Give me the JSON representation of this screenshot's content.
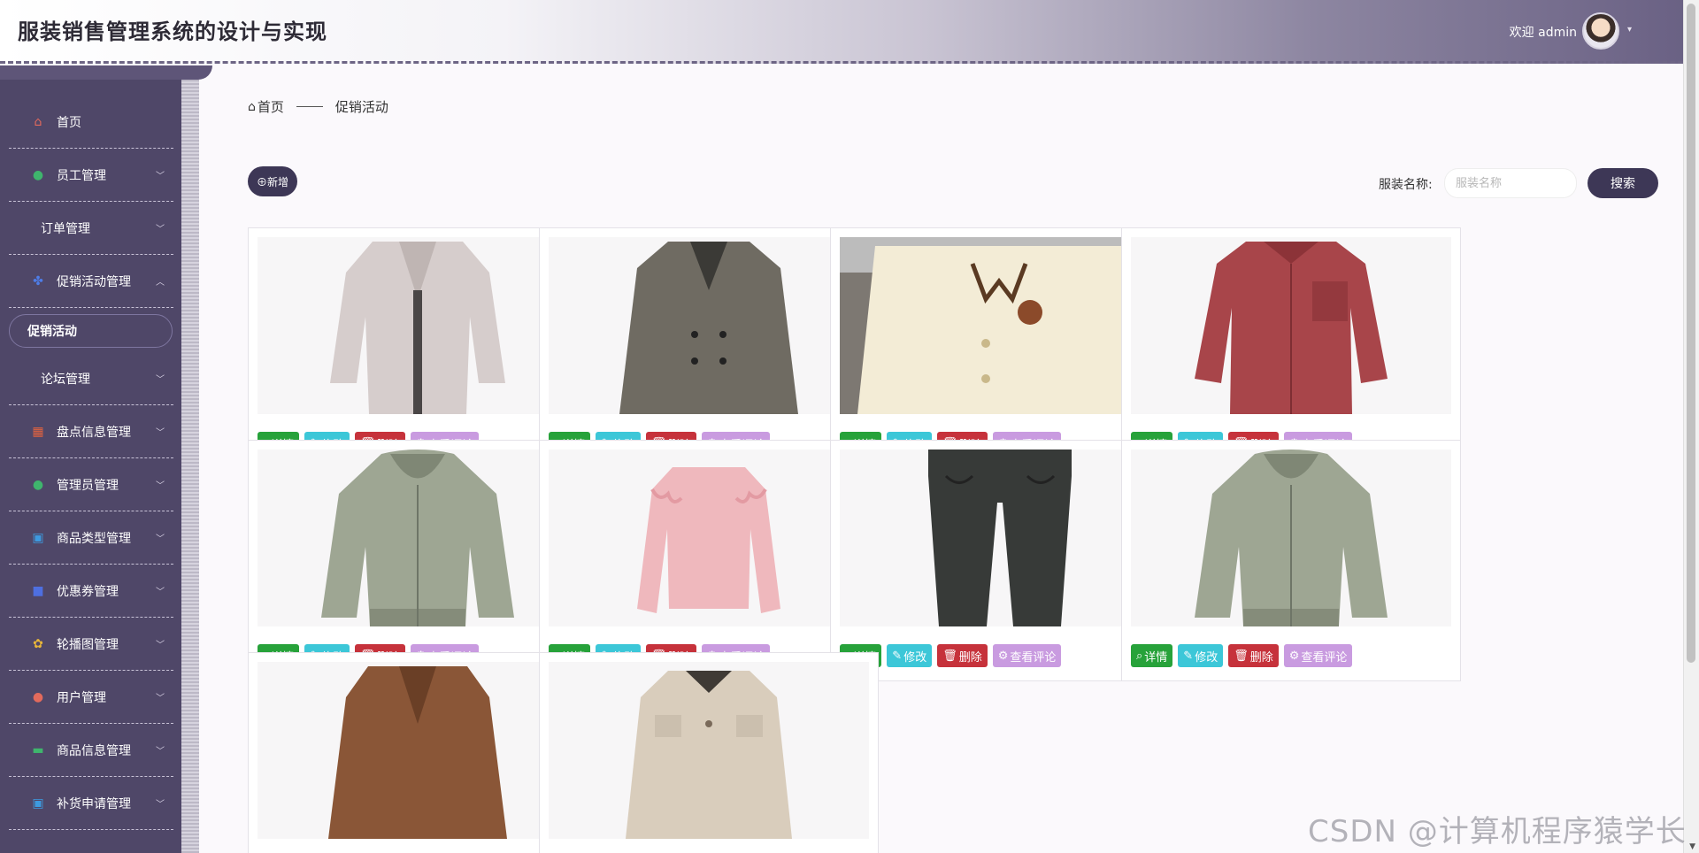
{
  "header": {
    "title": "服装销售管理系统的设计与实现",
    "welcome": "欢迎 admin"
  },
  "sidebar": {
    "items": [
      {
        "label": "首页",
        "icon": "home-icon",
        "color": "#e36a5c",
        "chevron": false,
        "iconShown": true
      },
      {
        "label": "员工管理",
        "icon": "person-icon",
        "color": "#3fb56d",
        "chevron": true,
        "iconShown": true
      },
      {
        "label": "订单管理",
        "icon": "",
        "color": "",
        "chevron": true,
        "iconShown": false
      },
      {
        "label": "促销活动管理",
        "icon": "grid-flower-icon",
        "color": "#4e7de8",
        "chevron": true,
        "expanded": true,
        "iconShown": true
      },
      {
        "label": "论坛管理",
        "icon": "",
        "color": "",
        "chevron": true,
        "iconShown": false
      },
      {
        "label": "盘点信息管理",
        "icon": "table-icon",
        "color": "#e3633f",
        "chevron": true,
        "iconShown": true
      },
      {
        "label": "管理员管理",
        "icon": "person-icon",
        "color": "#3fb56d",
        "chevron": true,
        "iconShown": true
      },
      {
        "label": "商品类型管理",
        "icon": "window-icon",
        "color": "#3d9ae0",
        "chevron": true,
        "iconShown": true
      },
      {
        "label": "优惠券管理",
        "icon": "folder-icon",
        "color": "#4e6fe0",
        "chevron": true,
        "iconShown": true
      },
      {
        "label": "轮播图管理",
        "icon": "flower-icon",
        "color": "#e8b63a",
        "chevron": true,
        "iconShown": true
      },
      {
        "label": "用户管理",
        "icon": "person-icon",
        "color": "#e36a5c",
        "chevron": true,
        "iconShown": true
      },
      {
        "label": "商品信息管理",
        "icon": "chat-icon",
        "color": "#3fb56d",
        "chevron": true,
        "iconShown": true
      },
      {
        "label": "补货申请管理",
        "icon": "window-icon",
        "color": "#3d9ae0",
        "chevron": true,
        "iconShown": true
      }
    ],
    "active_sub": "促销活动"
  },
  "breadcrumb": {
    "home": "首页",
    "current": "促销活动"
  },
  "toolbar": {
    "add_label": "⊕新增",
    "search_label": "服装名称:",
    "search_placeholder": "服装名称",
    "search_button": "搜索"
  },
  "card_actions": {
    "detail": "详情",
    "edit": "修改",
    "delete": "删除",
    "comments": "查看评论"
  },
  "cards": [
    {
      "kind": "coat-light"
    },
    {
      "kind": "blazer-plaid"
    },
    {
      "kind": "cardigan-cream"
    },
    {
      "kind": "shirt-red"
    },
    {
      "kind": "hoodie-green"
    },
    {
      "kind": "sweater-pink"
    },
    {
      "kind": "pants-black"
    },
    {
      "kind": "hoodie-green"
    },
    {
      "kind": "coat-brown"
    },
    {
      "kind": "jacket-beige"
    }
  ],
  "watermark": "CSDN @计算机程序猿学长"
}
